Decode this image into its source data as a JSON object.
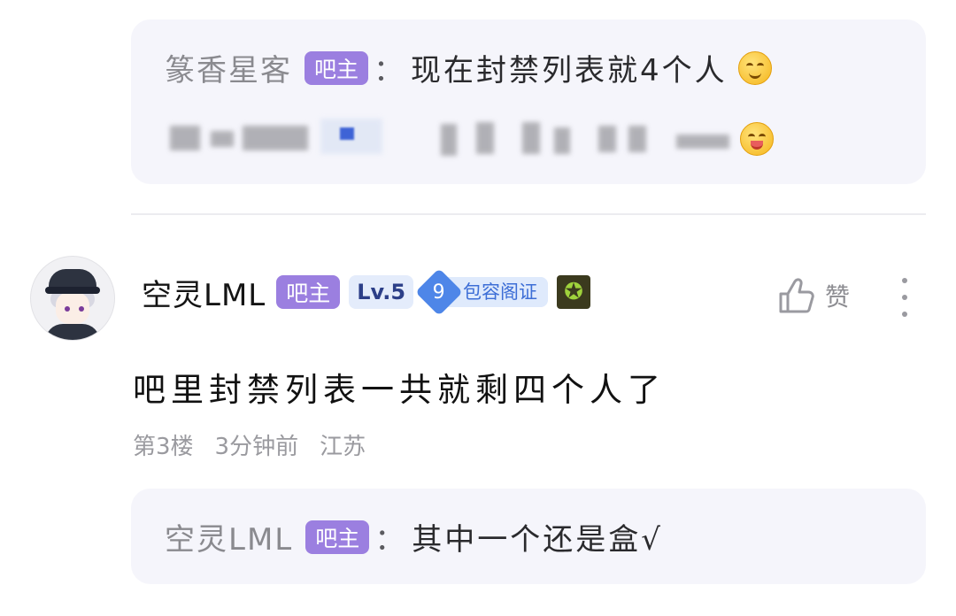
{
  "reply_top": {
    "username": "篆香星客",
    "badge": "吧主",
    "colon": "：",
    "text": "现在封禁列表就4个人",
    "emoji_1": "smiling-face-icon",
    "emoji_2": "tongue-face-icon"
  },
  "post": {
    "username": "空灵LML",
    "badge_owner": "吧主",
    "level": "Lv.5",
    "cert_level": "9",
    "cert_label": "包容阁证",
    "medal_icon": "star-medal-icon",
    "like_label": "赞",
    "content": "吧里封禁列表一共就剩四个人了",
    "floor": "第3楼",
    "time": "3分钟前",
    "location": "江苏"
  },
  "reply_bottom": {
    "username": "空灵LML",
    "badge": "吧主",
    "colon": "：",
    "text": "其中一个还是盒√"
  },
  "colors": {
    "owner_badge": "#9b7fe0",
    "reply_bg": "#f5f5fb",
    "level_bg": "#e4ecfb",
    "cert_blue": "#4e86e8"
  }
}
